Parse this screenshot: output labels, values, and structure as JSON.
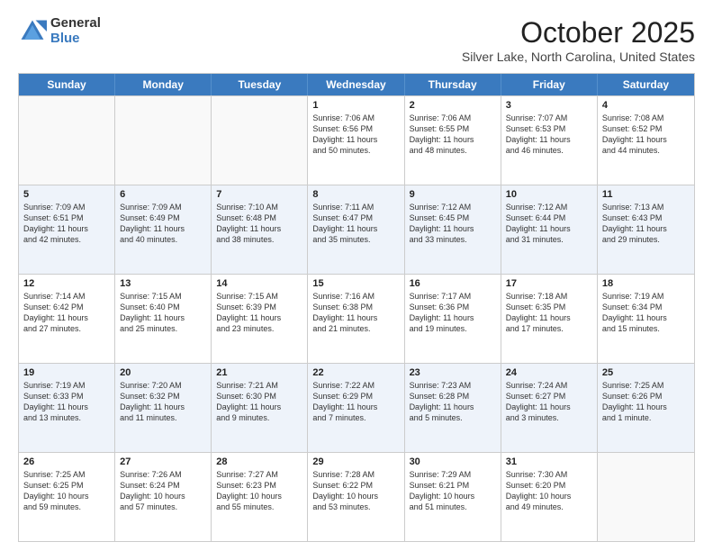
{
  "logo": {
    "general": "General",
    "blue": "Blue"
  },
  "header": {
    "title": "October 2025",
    "location": "Silver Lake, North Carolina, United States"
  },
  "weekdays": [
    "Sunday",
    "Monday",
    "Tuesday",
    "Wednesday",
    "Thursday",
    "Friday",
    "Saturday"
  ],
  "rows": [
    [
      {
        "day": "",
        "info": ""
      },
      {
        "day": "",
        "info": ""
      },
      {
        "day": "",
        "info": ""
      },
      {
        "day": "1",
        "info": "Sunrise: 7:06 AM\nSunset: 6:56 PM\nDaylight: 11 hours\nand 50 minutes."
      },
      {
        "day": "2",
        "info": "Sunrise: 7:06 AM\nSunset: 6:55 PM\nDaylight: 11 hours\nand 48 minutes."
      },
      {
        "day": "3",
        "info": "Sunrise: 7:07 AM\nSunset: 6:53 PM\nDaylight: 11 hours\nand 46 minutes."
      },
      {
        "day": "4",
        "info": "Sunrise: 7:08 AM\nSunset: 6:52 PM\nDaylight: 11 hours\nand 44 minutes."
      }
    ],
    [
      {
        "day": "5",
        "info": "Sunrise: 7:09 AM\nSunset: 6:51 PM\nDaylight: 11 hours\nand 42 minutes."
      },
      {
        "day": "6",
        "info": "Sunrise: 7:09 AM\nSunset: 6:49 PM\nDaylight: 11 hours\nand 40 minutes."
      },
      {
        "day": "7",
        "info": "Sunrise: 7:10 AM\nSunset: 6:48 PM\nDaylight: 11 hours\nand 38 minutes."
      },
      {
        "day": "8",
        "info": "Sunrise: 7:11 AM\nSunset: 6:47 PM\nDaylight: 11 hours\nand 35 minutes."
      },
      {
        "day": "9",
        "info": "Sunrise: 7:12 AM\nSunset: 6:45 PM\nDaylight: 11 hours\nand 33 minutes."
      },
      {
        "day": "10",
        "info": "Sunrise: 7:12 AM\nSunset: 6:44 PM\nDaylight: 11 hours\nand 31 minutes."
      },
      {
        "day": "11",
        "info": "Sunrise: 7:13 AM\nSunset: 6:43 PM\nDaylight: 11 hours\nand 29 minutes."
      }
    ],
    [
      {
        "day": "12",
        "info": "Sunrise: 7:14 AM\nSunset: 6:42 PM\nDaylight: 11 hours\nand 27 minutes."
      },
      {
        "day": "13",
        "info": "Sunrise: 7:15 AM\nSunset: 6:40 PM\nDaylight: 11 hours\nand 25 minutes."
      },
      {
        "day": "14",
        "info": "Sunrise: 7:15 AM\nSunset: 6:39 PM\nDaylight: 11 hours\nand 23 minutes."
      },
      {
        "day": "15",
        "info": "Sunrise: 7:16 AM\nSunset: 6:38 PM\nDaylight: 11 hours\nand 21 minutes."
      },
      {
        "day": "16",
        "info": "Sunrise: 7:17 AM\nSunset: 6:36 PM\nDaylight: 11 hours\nand 19 minutes."
      },
      {
        "day": "17",
        "info": "Sunrise: 7:18 AM\nSunset: 6:35 PM\nDaylight: 11 hours\nand 17 minutes."
      },
      {
        "day": "18",
        "info": "Sunrise: 7:19 AM\nSunset: 6:34 PM\nDaylight: 11 hours\nand 15 minutes."
      }
    ],
    [
      {
        "day": "19",
        "info": "Sunrise: 7:19 AM\nSunset: 6:33 PM\nDaylight: 11 hours\nand 13 minutes."
      },
      {
        "day": "20",
        "info": "Sunrise: 7:20 AM\nSunset: 6:32 PM\nDaylight: 11 hours\nand 11 minutes."
      },
      {
        "day": "21",
        "info": "Sunrise: 7:21 AM\nSunset: 6:30 PM\nDaylight: 11 hours\nand 9 minutes."
      },
      {
        "day": "22",
        "info": "Sunrise: 7:22 AM\nSunset: 6:29 PM\nDaylight: 11 hours\nand 7 minutes."
      },
      {
        "day": "23",
        "info": "Sunrise: 7:23 AM\nSunset: 6:28 PM\nDaylight: 11 hours\nand 5 minutes."
      },
      {
        "day": "24",
        "info": "Sunrise: 7:24 AM\nSunset: 6:27 PM\nDaylight: 11 hours\nand 3 minutes."
      },
      {
        "day": "25",
        "info": "Sunrise: 7:25 AM\nSunset: 6:26 PM\nDaylight: 11 hours\nand 1 minute."
      }
    ],
    [
      {
        "day": "26",
        "info": "Sunrise: 7:25 AM\nSunset: 6:25 PM\nDaylight: 10 hours\nand 59 minutes."
      },
      {
        "day": "27",
        "info": "Sunrise: 7:26 AM\nSunset: 6:24 PM\nDaylight: 10 hours\nand 57 minutes."
      },
      {
        "day": "28",
        "info": "Sunrise: 7:27 AM\nSunset: 6:23 PM\nDaylight: 10 hours\nand 55 minutes."
      },
      {
        "day": "29",
        "info": "Sunrise: 7:28 AM\nSunset: 6:22 PM\nDaylight: 10 hours\nand 53 minutes."
      },
      {
        "day": "30",
        "info": "Sunrise: 7:29 AM\nSunset: 6:21 PM\nDaylight: 10 hours\nand 51 minutes."
      },
      {
        "day": "31",
        "info": "Sunrise: 7:30 AM\nSunset: 6:20 PM\nDaylight: 10 hours\nand 49 minutes."
      },
      {
        "day": "",
        "info": ""
      }
    ]
  ],
  "altRows": [
    1,
    3
  ]
}
